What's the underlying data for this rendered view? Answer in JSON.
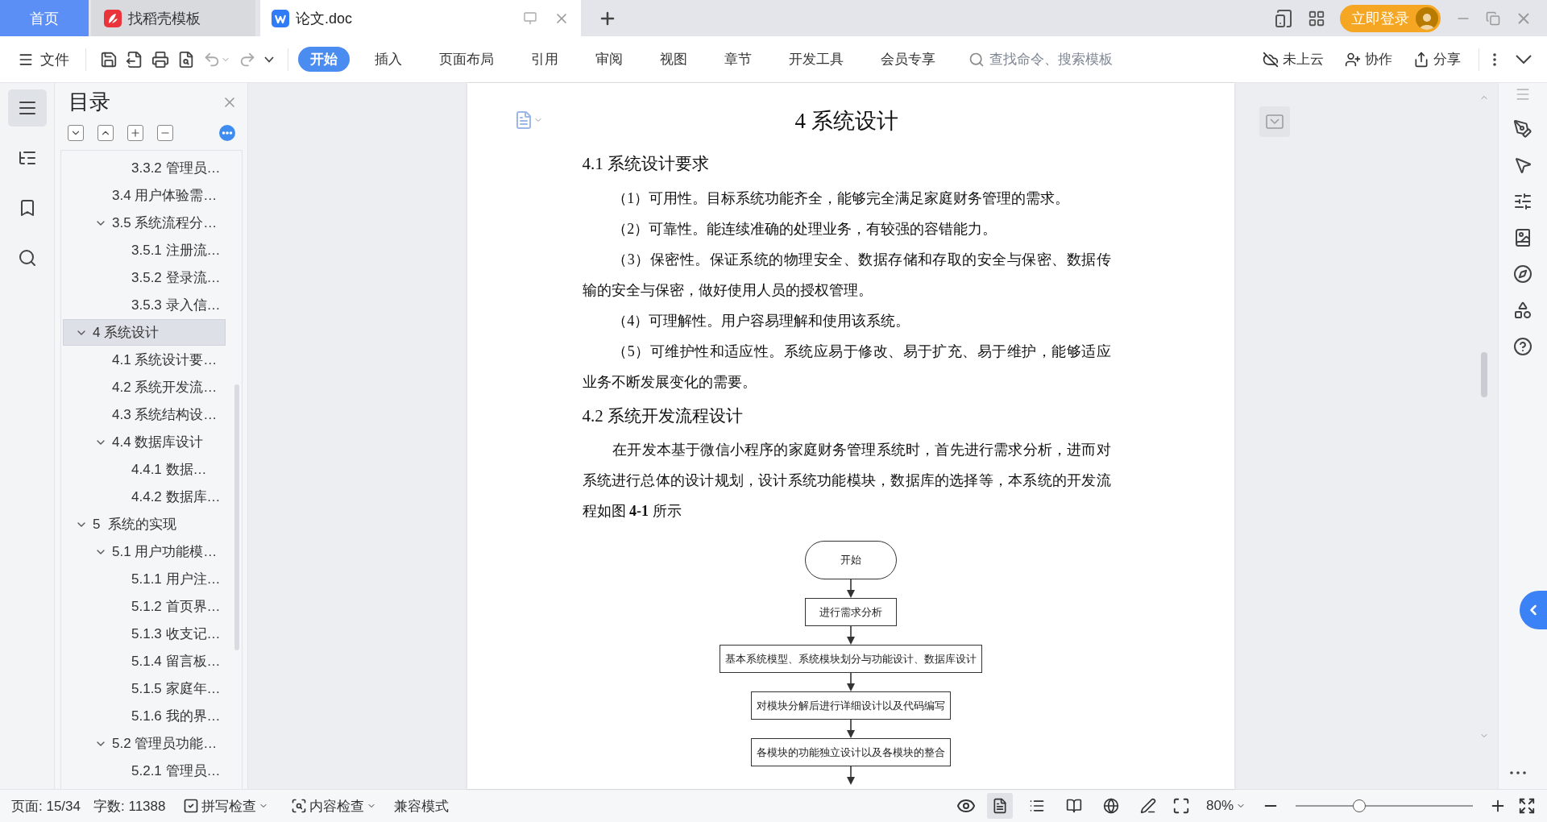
{
  "tabs": [
    {
      "label": "首页",
      "kind": "home",
      "selected": false
    },
    {
      "label": "找稻壳模板",
      "kind": "template",
      "selected": false
    },
    {
      "label": "论文.doc",
      "kind": "document",
      "selected": true
    }
  ],
  "account": {
    "login": "立即登录"
  },
  "toolbar": {
    "file": "文件",
    "ribbon_tabs": [
      {
        "label": "开始",
        "selected": true
      },
      {
        "label": "插入",
        "selected": false
      },
      {
        "label": "页面布局",
        "selected": false
      },
      {
        "label": "引用",
        "selected": false
      },
      {
        "label": "审阅",
        "selected": false
      },
      {
        "label": "视图",
        "selected": false
      },
      {
        "label": "章节",
        "selected": false
      },
      {
        "label": "开发工具",
        "selected": false
      },
      {
        "label": "会员专享",
        "selected": false
      }
    ],
    "search": {
      "placeholder": "查找命令、搜索模板"
    },
    "actions": [
      {
        "kind": "cloud",
        "label": "未上云"
      },
      {
        "kind": "collab",
        "label": "协作"
      },
      {
        "kind": "share",
        "label": "分享"
      }
    ]
  },
  "outline": {
    "title": "目录",
    "items": [
      {
        "children": [
          {
            "children": [
              {
                "label": "3.3.2 管理员…",
                "selected": false
              }
            ]
          },
          {
            "label": "3.4 用户体验需…",
            "selected": false
          },
          {
            "label": "3.5 系统流程分…",
            "selected": false,
            "expanded": true,
            "children": [
              {
                "label": "3.5.1 注册流…",
                "selected": false
              },
              {
                "label": "3.5.2 登录流…",
                "selected": false
              },
              {
                "label": "3.5.3 录入信…",
                "selected": false
              }
            ]
          }
        ]
      },
      {
        "label": "4 系统设计",
        "selected": true,
        "expanded": true,
        "children": [
          {
            "label": "4.1 系统设计要…",
            "selected": false
          },
          {
            "label": "4.2 系统开发流…",
            "selected": false
          },
          {
            "label": "4.3 系统结构设…",
            "selected": false
          },
          {
            "label": "4.4 数据库设计",
            "selected": false,
            "expanded": true,
            "children": [
              {
                "label": "4.4.1 数据…",
                "selected": false
              },
              {
                "label": "4.4.2 数据库…",
                "selected": false
              }
            ]
          }
        ]
      },
      {
        "label": "5  系统的实现",
        "selected": false,
        "expanded": true,
        "children": [
          {
            "label": "5.1 用户功能模…",
            "selected": false,
            "expanded": true,
            "children": [
              {
                "label": "5.1.1 用户注…",
                "selected": false
              },
              {
                "label": "5.1.2 首页界…",
                "selected": false
              },
              {
                "label": "5.1.3 收支记…",
                "selected": false
              },
              {
                "label": "5.1.4 留言板…",
                "selected": false
              },
              {
                "label": "5.1.5 家庭年…",
                "selected": false
              },
              {
                "label": "5.1.6 我的界…",
                "selected": false
              }
            ]
          },
          {
            "label": "5.2 管理员功能…",
            "selected": false,
            "expanded": true,
            "children": [
              {
                "label": "5.2.1 管理员…",
                "selected": false
              }
            ]
          }
        ]
      }
    ]
  },
  "document": {
    "title": "4 系统设计",
    "sections": [
      {
        "heading": "4.1 系统设计要求",
        "paragraphs": [
          "（1）可用性。目标系统功能齐全，能够完全满足家庭财务管理的需求。",
          "（2）可靠性。能连续准确的处理业务，有较强的容错能力。",
          "（3）保密性。保证系统的物理安全、数据存储和存取的安全与保密、数据传输的安全与保密，做好使用人员的授权管理。",
          "（4）可理解性。用户容易理解和使用该系统。",
          "（5）可维护性和适应性。系统应易于修改、易于扩充、易于维护，能够适应业务不断发展变化的需要。"
        ]
      },
      {
        "heading": "4.2 系统开发流程设计",
        "paragraphs": [
          "在开发本基于微信小程序的家庭财务管理系统时，首先进行需求分析，进而对系统进行总体的设计规划，设计系统功能模块，数据库的选择等，本系统的开发流程如图 **4-1** 所示"
        ]
      }
    ],
    "flowchart": [
      {
        "kind": "terminal",
        "label": "开始"
      },
      {
        "kind": "process",
        "label": "进行需求分析"
      },
      {
        "kind": "process",
        "label": "基本系统模型、系统模块划分与功能设计、数据库设计"
      },
      {
        "kind": "process",
        "label": "对模块分解后进行详细设计以及代码编写"
      },
      {
        "kind": "process",
        "label": "各模块的功能独立设计以及各模块的整合"
      }
    ]
  },
  "status_bar": {
    "page": "页面: 15/34",
    "words": "字数: 11388",
    "spell_check": "拼写检查",
    "content_check": "内容检查",
    "mode": "兼容模式",
    "views": [
      {
        "kind": "page",
        "selected": true
      },
      {
        "kind": "outline",
        "selected": false
      },
      {
        "kind": "reading",
        "selected": false
      },
      {
        "kind": "web",
        "selected": false
      },
      {
        "kind": "writing",
        "selected": false
      }
    ],
    "zoom": "80%",
    "zoom_slider": {
      "level": 0.36
    }
  }
}
